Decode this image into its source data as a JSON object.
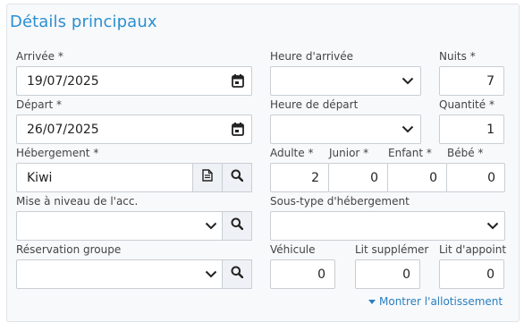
{
  "title": "Détails principaux",
  "fields": {
    "arrival": {
      "label": "Arrivée *",
      "value": "19/07/2025"
    },
    "departure": {
      "label": "Départ *",
      "value": "26/07/2025"
    },
    "accommodation": {
      "label": "Hébergement *",
      "value": "Kiwi"
    },
    "upgrade": {
      "label": "Mise à niveau de l'acc.",
      "value": ""
    },
    "group_booking": {
      "label": "Réservation groupe",
      "value": ""
    },
    "arrival_time": {
      "label": "Heure d'arrivée",
      "value": ""
    },
    "departure_time": {
      "label": "Heure de départ",
      "value": ""
    },
    "nights": {
      "label": "Nuits *",
      "value": "7"
    },
    "quantity": {
      "label": "Quantité *",
      "value": "1"
    },
    "adult": {
      "label": "Adulte *",
      "value": "2"
    },
    "junior": {
      "label": "Junior *",
      "value": "0"
    },
    "child": {
      "label": "Enfant *",
      "value": "0"
    },
    "baby": {
      "label": "Bébé *",
      "value": "0"
    },
    "subtype": {
      "label": "Sous-type d'hébergement",
      "value": ""
    },
    "vehicle": {
      "label": "Véhicule",
      "value": "0"
    },
    "extra_bed": {
      "label": "Lit supplémer",
      "value": "0"
    },
    "spare_bed": {
      "label": "Lit d'appoint",
      "value": "0"
    }
  },
  "show_allotment": "Montrer l'allotissement",
  "icons": [
    "calendar-icon",
    "chevron-down-icon",
    "search-icon",
    "document-icon",
    "caret-down-icon"
  ],
  "colors": {
    "accent": "#2a8fd1",
    "link": "#2a7fc0",
    "border": "#c9ced4",
    "button_bg": "#eef2f6"
  }
}
